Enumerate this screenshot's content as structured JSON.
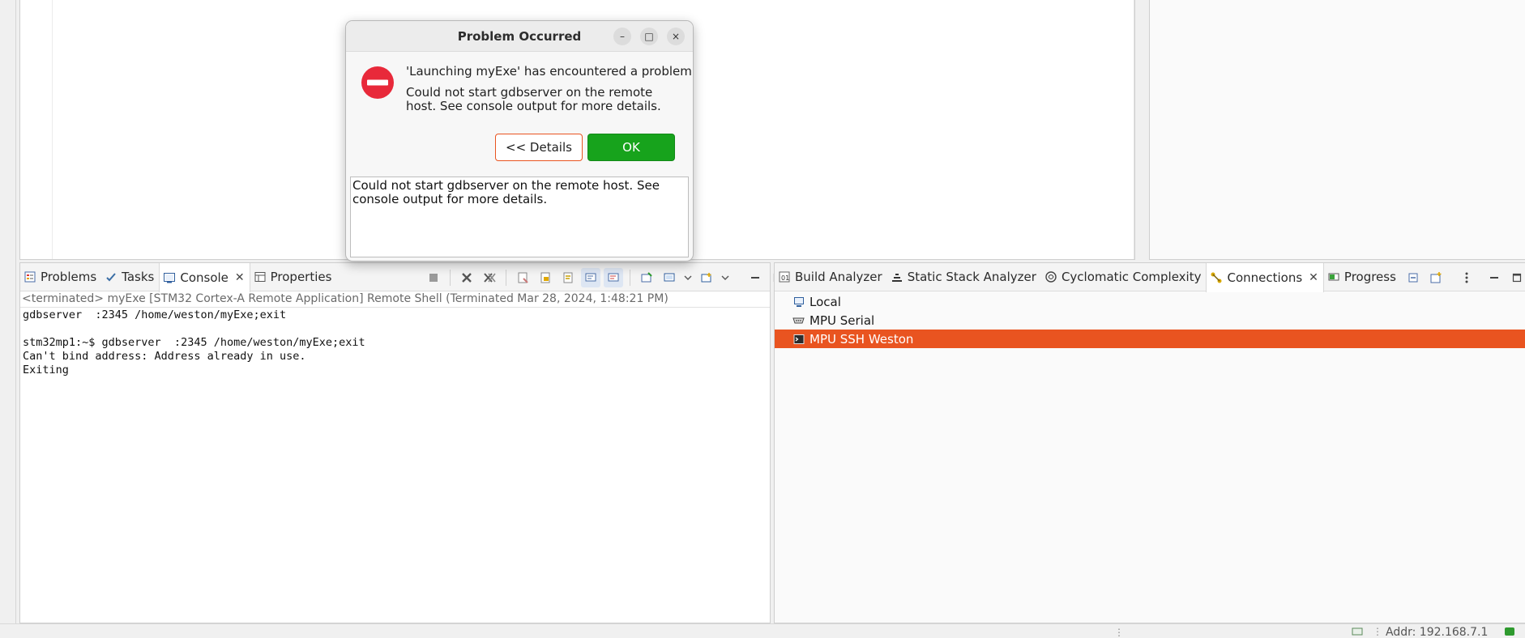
{
  "dialog": {
    "title": "Problem Occurred",
    "heading": "'Launching myExe' has encountered a problem.",
    "message": "Could not start gdbserver on the remote host. See console output for more details.",
    "details_button": "<< Details",
    "ok_button": "OK",
    "details_text": "Could not start gdbserver on the remote host. See console output for more details.",
    "window_buttons": {
      "minimize": "–",
      "maximize": "□",
      "close": "×"
    }
  },
  "console_view": {
    "tabs": [
      {
        "label": "Problems",
        "icon": "problems-icon"
      },
      {
        "label": "Tasks",
        "icon": "tasks-icon"
      },
      {
        "label": "Console",
        "icon": "console-icon",
        "active": true
      },
      {
        "label": "Properties",
        "icon": "properties-icon"
      }
    ],
    "status_line": "<terminated> myExe [STM32 Cortex-A Remote Application] Remote Shell (Terminated Mar 28, 2024, 1:48:21 PM)",
    "output": "gdbserver  :2345 /home/weston/myExe;exit\n\nstm32mp1:~$ gdbserver  :2345 /home/weston/myExe;exit\nCan't bind address: Address already in use.\nExiting"
  },
  "connections_view": {
    "tabs": [
      {
        "label": "Build Analyzer",
        "icon": "build-analyzer-icon"
      },
      {
        "label": "Static Stack Analyzer",
        "icon": "stack-analyzer-icon"
      },
      {
        "label": "Cyclomatic Complexity",
        "icon": "complexity-icon"
      },
      {
        "label": "Connections",
        "icon": "connections-icon",
        "active": true
      },
      {
        "label": "Progress",
        "icon": "progress-icon"
      }
    ],
    "items": [
      {
        "label": "Local",
        "icon": "local-computer-icon"
      },
      {
        "label": "MPU Serial",
        "icon": "serial-port-icon"
      },
      {
        "label": "MPU SSH Weston",
        "icon": "ssh-terminal-icon",
        "selected": true
      }
    ]
  },
  "status_bar": {
    "address": "Addr: 192.168.7.1"
  },
  "colors": {
    "accent": "#e95420",
    "ok_green": "#17a31c",
    "error_red": "#e8293a"
  }
}
